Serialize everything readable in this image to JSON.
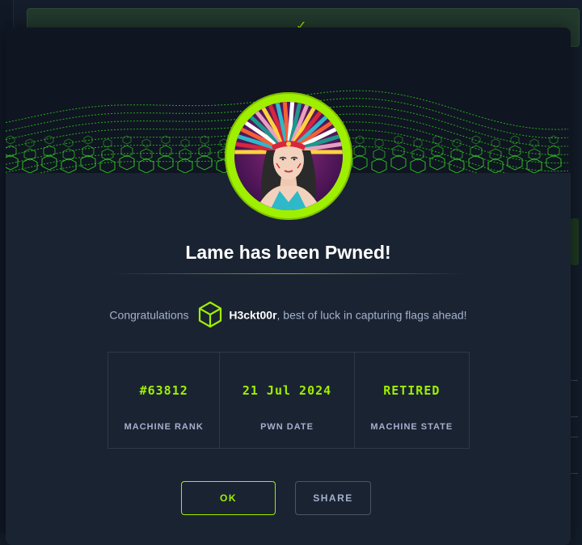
{
  "background": {
    "check_glyph": "✓"
  },
  "modal": {
    "title": "Lame has been Pwned!",
    "congrats_prefix": "Congratulations",
    "username": "H3ckt00r",
    "congrats_suffix": ", best of luck in capturing flags ahead!",
    "stats": [
      {
        "value": "#63812",
        "label": "MACHINE RANK"
      },
      {
        "value": "21 Jul 2024",
        "label": "PWN DATE"
      },
      {
        "value": "RETIRED",
        "label": "MACHINE STATE"
      }
    ],
    "ok_label": "OK",
    "share_label": "SHARE"
  },
  "colors": {
    "accent": "#9fef00",
    "background": "#141d2b",
    "modal": "#1a2332",
    "muted_text": "#a4b1cd"
  },
  "icons": {
    "banner": "green-wireframe-wave",
    "avatar": "machine-avatar-aztec-woman",
    "user_icon": "hexagon-cube-icon",
    "success": "check-icon"
  }
}
